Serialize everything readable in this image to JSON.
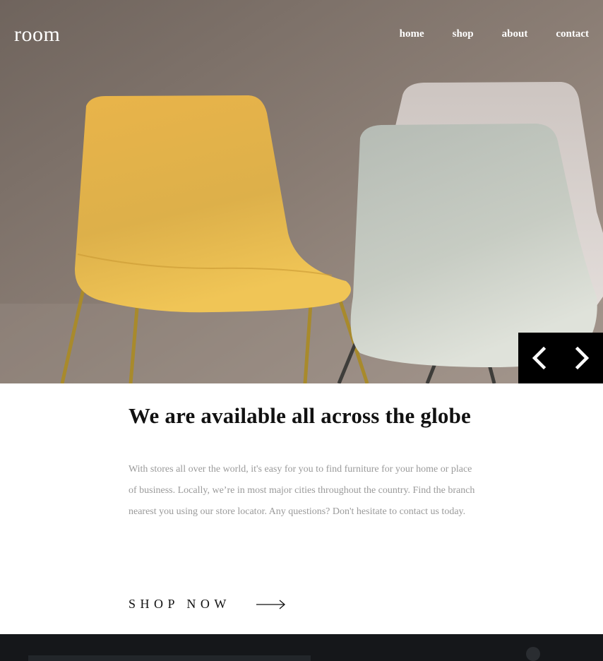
{
  "header": {
    "logo": "room",
    "nav": [
      {
        "label": "home"
      },
      {
        "label": "shop"
      },
      {
        "label": "about"
      },
      {
        "label": "contact"
      }
    ]
  },
  "hero": {
    "image": "chairs-photo",
    "prev_icon": "chevron-left-icon",
    "next_icon": "chevron-right-icon"
  },
  "about": {
    "heading": "We are available all across the globe",
    "body": "With stores all over the world, it's easy for you to find furniture for your home or place of business. Locally, we’re in most major cities throughout the country. Find the branch nearest you using our store locator. Any questions? Don't hesitate to contact us today.",
    "cta_label": "SHOP NOW",
    "cta_icon": "arrow-right-icon"
  },
  "colors": {
    "accent": "#000000",
    "text": "#111111",
    "muted": "#9a9a9a",
    "chair_yellow": "#e8b544",
    "chair_gray": "#c9cfc6"
  }
}
